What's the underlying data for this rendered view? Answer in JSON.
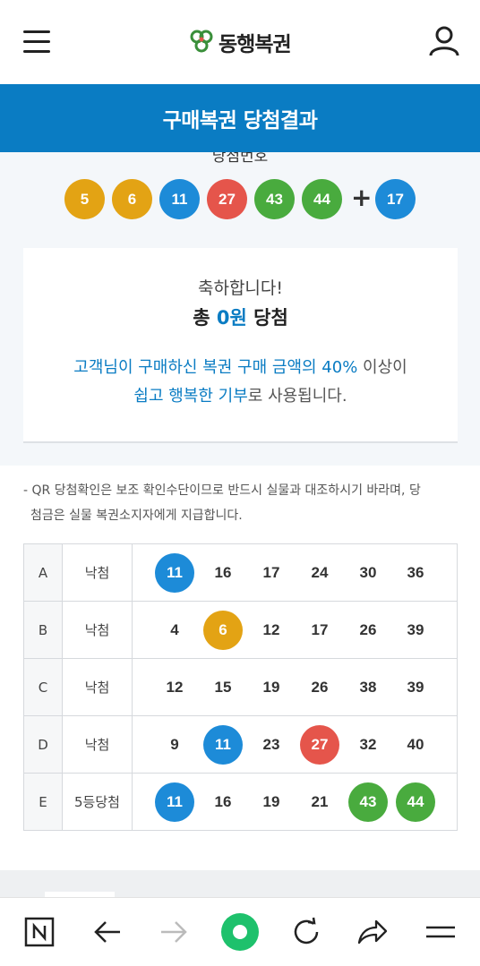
{
  "app": {
    "logo_text": "동행복권"
  },
  "page": {
    "title": "구매복권 당첨결과"
  },
  "winning": {
    "label": "당첨번호",
    "numbers": [
      5,
      6,
      11,
      27,
      43,
      44
    ],
    "bonus": 17,
    "plus": "+"
  },
  "result_card": {
    "congrats": "축하합니다!",
    "total_prefix": "총",
    "amount": "0원",
    "total_suffix": "당첨",
    "desc_line1_blue": "고객님이 구매하신 복권 구매 금액의 40%",
    "desc_line1_rest": " 이상이",
    "desc_line2_blue": "쉽고 행복한 기부",
    "desc_line2_rest": "로 사용됩니다."
  },
  "notice": {
    "line1": "- QR 당첨확인은 보조 확인수단이므로 반드시 실물과 대조하시기 바라며, 당",
    "line2": "  첨금은 실물 복권소지자에게 지급합니다."
  },
  "tickets": [
    {
      "id": "A",
      "status": "낙첨",
      "numbers": [
        11,
        16,
        17,
        24,
        30,
        36
      ]
    },
    {
      "id": "B",
      "status": "낙첨",
      "numbers": [
        4,
        6,
        12,
        17,
        26,
        39
      ]
    },
    {
      "id": "C",
      "status": "낙첨",
      "numbers": [
        12,
        15,
        19,
        26,
        38,
        39
      ]
    },
    {
      "id": "D",
      "status": "낙첨",
      "numbers": [
        9,
        11,
        23,
        27,
        32,
        40
      ]
    },
    {
      "id": "E",
      "status": "5등당첨",
      "numbers": [
        11,
        16,
        19,
        21,
        43,
        44
      ]
    }
  ],
  "colors": {
    "brand_blue": "#0a7cc3",
    "ball_yellow": "#e3a314",
    "ball_blue": "#1d8bd8",
    "ball_red": "#e5554b",
    "ball_green": "#49ab3e"
  },
  "icons": {
    "menu": "hamburger-icon",
    "user": "user-icon",
    "nav": [
      "naver-home-icon",
      "back-arrow-icon",
      "forward-arrow-icon",
      "green-dot-icon",
      "refresh-icon",
      "share-icon",
      "menu-lines-icon"
    ]
  }
}
